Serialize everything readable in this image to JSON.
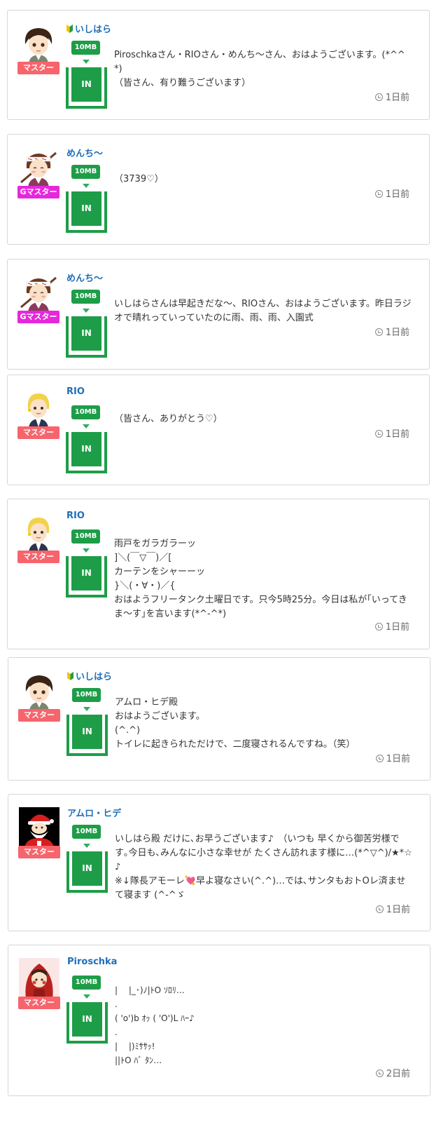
{
  "posts": [
    {
      "user": "いしはら",
      "beginner_mark": true,
      "avatar": "anime-boy-icon",
      "rank": "マスター",
      "rank_color": "#f7646c",
      "mb": "10MB",
      "status": "IN",
      "text": "Piroschkaさん・RIOさん・めんち〜さん、おはようございます。(*^^*)\n（皆さん、有り難うございます）",
      "time": "1日前"
    },
    {
      "user": "めんち〜",
      "beginner_mark": false,
      "avatar": "samurai-icon",
      "rank": "Gマスター",
      "rank_color": "#e628dc",
      "mb": "10MB",
      "status": "IN",
      "text": "（3739♡）",
      "time": "1日前"
    },
    {
      "user": "めんち〜",
      "beginner_mark": false,
      "avatar": "samurai-icon",
      "rank": "Gマスター",
      "rank_color": "#e628dc",
      "mb": "10MB",
      "status": "IN",
      "text": "いしはらさんは早起きだな〜、RIOさん、おはようございます。昨日ラジオで晴れっていっていたのに雨、雨、雨、入園式",
      "time": "1日前"
    },
    {
      "user": "RIO",
      "beginner_mark": false,
      "avatar": "blonde-businessman-icon",
      "rank": "マスター",
      "rank_color": "#f7646c",
      "mb": "10MB",
      "status": "IN",
      "text": "（皆さん、ありがとう♡）",
      "time": "1日前"
    },
    {
      "user": "RIO",
      "beginner_mark": false,
      "avatar": "blonde-businessman-icon",
      "rank": "マスター",
      "rank_color": "#f7646c",
      "mb": "10MB",
      "status": "IN",
      "text": "雨戸をガラガラーッ\n]＼(￣▽￣)／[\nカーテンをシャーーッ\n}＼(・∀・)／{\nおはようフリータンク土曜日です。只今5時25分。今日は私が｢いってきま〜す｣を言います(*^-^*)",
      "time": "1日前"
    },
    {
      "user": "いしはら",
      "beginner_mark": true,
      "avatar": "anime-boy-icon",
      "rank": "マスター",
      "rank_color": "#f7646c",
      "mb": "10MB",
      "status": "IN",
      "text": "アムロ・ヒデ殿\nおはようございます。\n(^.^)\nトイレに起きられただけで、二度寝されるんですね。（笑）",
      "time": "1日前"
    },
    {
      "user": "アムロ・ヒデ",
      "beginner_mark": false,
      "avatar": "santa-icon",
      "rank": "マスター",
      "rank_color": "#f7646c",
      "mb": "10MB",
      "status": "IN",
      "text": "いしはら殿 だけに､お早うございます♪　（いつも 早くから御苦労様です｡今日も､みんなに小さな幸せが たくさん訪れます様に…(*^▽^)/★*☆♪\n※↓隊長アモーレ💘早よ寝なさい(^.^)…では､サンタもおトОレ済ませて寝ます (^-^ゞ",
      "time": "1日前"
    },
    {
      "user": "Piroschka",
      "beginner_mark": false,
      "avatar": "red-hood-girl-icon",
      "rank": "マスター",
      "rank_color": "#f7646c",
      "mb": "10MB",
      "status": "IN",
      "text": "|　 |_･)ﾉ|ﾄO ｿﾛﾘ…\n.\n( 'o')b ｵｯ ( 'O')L ﾊｰ♪\n.\n|　 |)ﾐｻｻｯ!\n||ﾄO ﾊﾞ ﾀﾝ…",
      "time": "2日前"
    }
  ]
}
